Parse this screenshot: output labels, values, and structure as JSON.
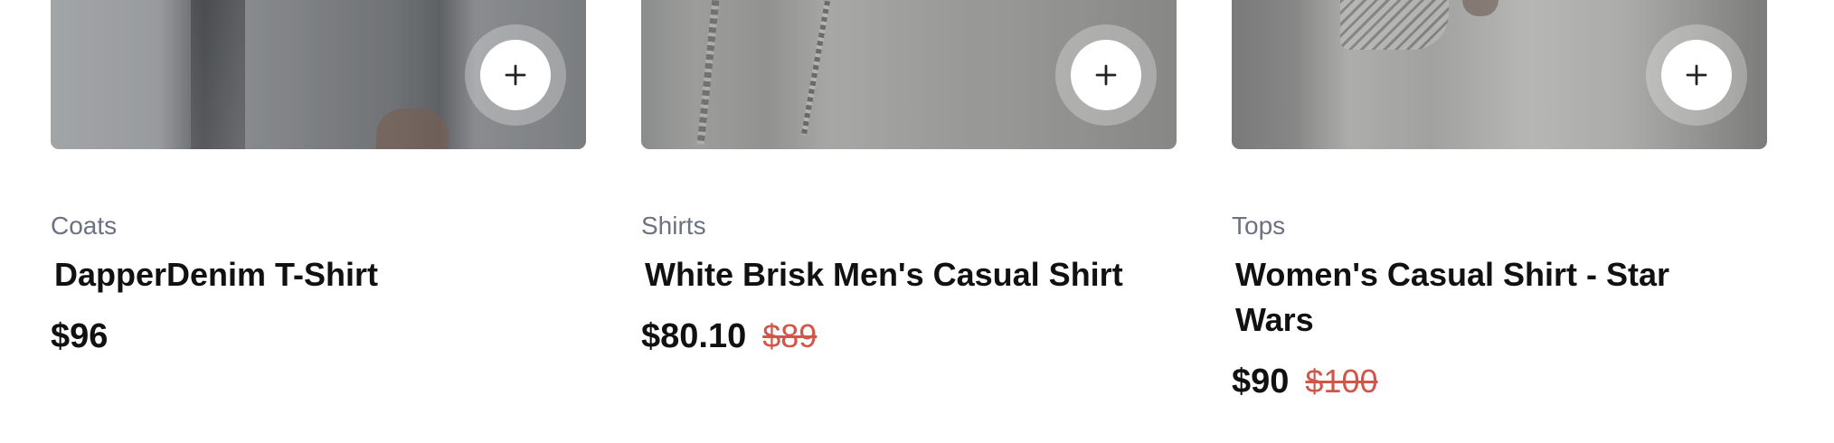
{
  "products": [
    {
      "category": "Coats",
      "name": "DapperDenim T-Shirt",
      "price": "$96",
      "old_price": ""
    },
    {
      "category": "Shirts",
      "name": "White Brisk Men's Casual Shirt",
      "price": "$80.10",
      "old_price": "$89"
    },
    {
      "category": "Tops",
      "name": "Women's Casual Shirt - Star Wars",
      "price": "$90",
      "old_price": "$100"
    }
  ],
  "icons": {
    "add": "plus-icon"
  },
  "colors": {
    "category": "#6b7280",
    "price": "#111111",
    "old_price": "#d2554a"
  }
}
